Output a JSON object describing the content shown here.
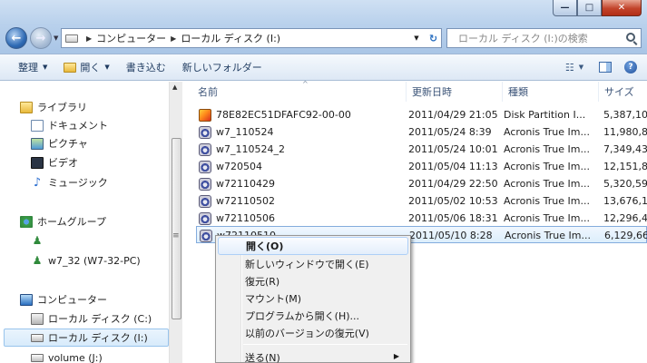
{
  "window": {
    "min_label": "—",
    "max_label": "□",
    "close_label": "✕"
  },
  "address": {
    "segments": [
      "コンピューター",
      "ローカル ディスク (I:)"
    ]
  },
  "search": {
    "placeholder": "ローカル ディスク (I:)の検索"
  },
  "toolbar": {
    "organize": "整理",
    "open": "開く",
    "burn": "書き込む",
    "new_folder": "新しいフォルダー"
  },
  "sidebar": {
    "items": [
      {
        "label": "ライブラリ",
        "icon": "library-icon"
      },
      {
        "label": "ドキュメント",
        "icon": "document-icon"
      },
      {
        "label": "ピクチャ",
        "icon": "picture-icon"
      },
      {
        "label": "ビデオ",
        "icon": "video-icon"
      },
      {
        "label": "ミュージック",
        "icon": "music-icon"
      },
      {
        "label": "ホームグループ",
        "icon": "homegroup-icon"
      },
      {
        "label": "",
        "icon": "user-icon"
      },
      {
        "label": "w7_32 (W7-32-PC)",
        "icon": "user-icon"
      },
      {
        "label": "コンピューター",
        "icon": "computer-icon"
      },
      {
        "label": "ローカル ディスク (C:)",
        "icon": "drive-c-icon"
      },
      {
        "label": "ローカル ディスク (I:)",
        "icon": "drive-icon",
        "selected": true
      },
      {
        "label": "volume (J:)",
        "icon": "drive-icon"
      }
    ]
  },
  "filelist": {
    "columns": [
      "名前",
      "更新日時",
      "種類",
      "サイズ"
    ],
    "rows": [
      {
        "name": "78E82EC51DFAFC92-00-00",
        "date": "2011/04/29 21:05",
        "type": "Disk Partition I...",
        "size": "5,387,10",
        "icon": "partition-file-icon"
      },
      {
        "name": "w7_110524",
        "date": "2011/05/24 8:39",
        "type": "Acronis True Im...",
        "size": "11,980,8",
        "icon": "tib-file-icon"
      },
      {
        "name": "w7_110524_2",
        "date": "2011/05/24 10:01",
        "type": "Acronis True Im...",
        "size": "7,349,43",
        "icon": "tib-file-icon"
      },
      {
        "name": "w720504",
        "date": "2011/05/04 11:13",
        "type": "Acronis True Im...",
        "size": "12,151,8",
        "icon": "tib-file-icon"
      },
      {
        "name": "w72110429",
        "date": "2011/04/29 22:50",
        "type": "Acronis True Im...",
        "size": "5,320,59",
        "icon": "tib-file-icon"
      },
      {
        "name": "w72110502",
        "date": "2011/05/02 10:53",
        "type": "Acronis True Im...",
        "size": "13,676,1",
        "icon": "tib-file-icon"
      },
      {
        "name": "w72110506",
        "date": "2011/05/06 18:31",
        "type": "Acronis True Im...",
        "size": "12,296,4",
        "icon": "tib-file-icon"
      },
      {
        "name": "w72110510",
        "date": "2011/05/10 8:28",
        "type": "Acronis True Im...",
        "size": "6,129,66",
        "icon": "tib-file-icon",
        "selected": true
      }
    ]
  },
  "context_menu": {
    "items": [
      {
        "label": "開く(O)",
        "default": true,
        "highlighted": true
      },
      {
        "label": "新しいウィンドウで開く(E)"
      },
      {
        "label": "復元(R)"
      },
      {
        "label": "マウント(M)"
      },
      {
        "label": "プログラムから開く(H)..."
      },
      {
        "label": "以前のバージョンの復元(V)"
      },
      {
        "label": "送る(N)",
        "submenu": true
      }
    ]
  }
}
